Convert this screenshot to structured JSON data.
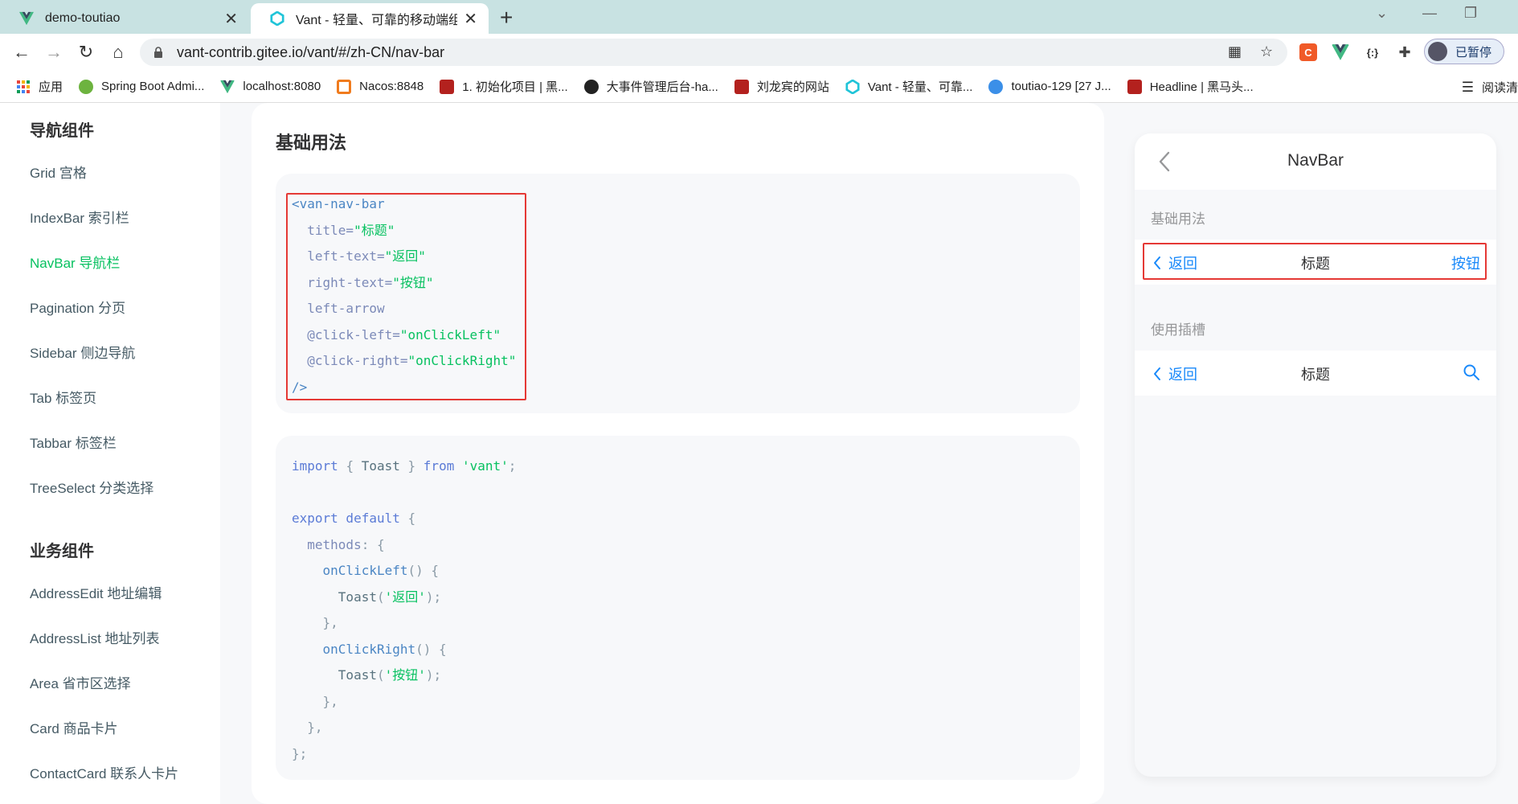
{
  "browser": {
    "tabs": [
      {
        "title": "demo-toutiao",
        "active": false
      },
      {
        "title": "Vant - 轻量、可靠的移动端组件库",
        "active": true
      }
    ],
    "new_tab": "+",
    "url_host": "vant-contrib.gitee.io",
    "url_path": "/vant/#/zh-CN/nav-bar",
    "profile_label": "已暂停",
    "ext_c_label": "C",
    "ext_braces_label": "{:}"
  },
  "bookmarks": [
    {
      "label": "应用"
    },
    {
      "label": "Spring Boot Admi..."
    },
    {
      "label": "localhost:8080"
    },
    {
      "label": "Nacos:8848"
    },
    {
      "label": "1. 初始化项目 | 黑..."
    },
    {
      "label": "大事件管理后台-ha..."
    },
    {
      "label": "刘龙宾的网站"
    },
    {
      "label": "Vant - 轻量、可靠..."
    },
    {
      "label": "toutiao-129 [27 J..."
    },
    {
      "label": "Headline | 黑马头..."
    }
  ],
  "reading_list": "阅读清",
  "sidebar": {
    "group_nav": "导航组件",
    "nav_items": [
      "Grid 宫格",
      "IndexBar 索引栏",
      "NavBar 导航栏",
      "Pagination 分页",
      "Sidebar 侧边导航",
      "Tab 标签页",
      "Tabbar 标签栏",
      "TreeSelect 分类选择"
    ],
    "active_item": "NavBar 导航栏",
    "group_biz": "业务组件",
    "biz_items": [
      "AddressEdit 地址编辑",
      "AddressList 地址列表",
      "Area 省市区选择",
      "Card 商品卡片",
      "ContactCard 联系人卡片"
    ]
  },
  "content": {
    "section_title": "基础用法",
    "template_code": [
      "<van-nav-bar",
      "  title=\"标题\"",
      "  left-text=\"返回\"",
      "  right-text=\"按钮\"",
      "  left-arrow",
      "  @click-left=\"onClickLeft\"",
      "  @click-right=\"onClickRight\"",
      "/>"
    ],
    "script_code": [
      "import { Toast } from 'vant';",
      "",
      "export default {",
      "  methods: {",
      "    onClickLeft() {",
      "      Toast('返回');",
      "    },",
      "    onClickRight() {",
      "      Toast('按钮');",
      "    },",
      "  },",
      "};"
    ]
  },
  "demo": {
    "title": "NavBar",
    "label_basic": "基础用法",
    "basic_left": "返回",
    "basic_title": "标题",
    "basic_right": "按钮",
    "label_slot": "使用插槽",
    "slot_left": "返回",
    "slot_title": "标题",
    "slot_right_icon": "search-icon"
  },
  "colors": {
    "accent_green": "#07c160",
    "link_blue": "#1989fa",
    "highlight_red": "#e53935"
  }
}
